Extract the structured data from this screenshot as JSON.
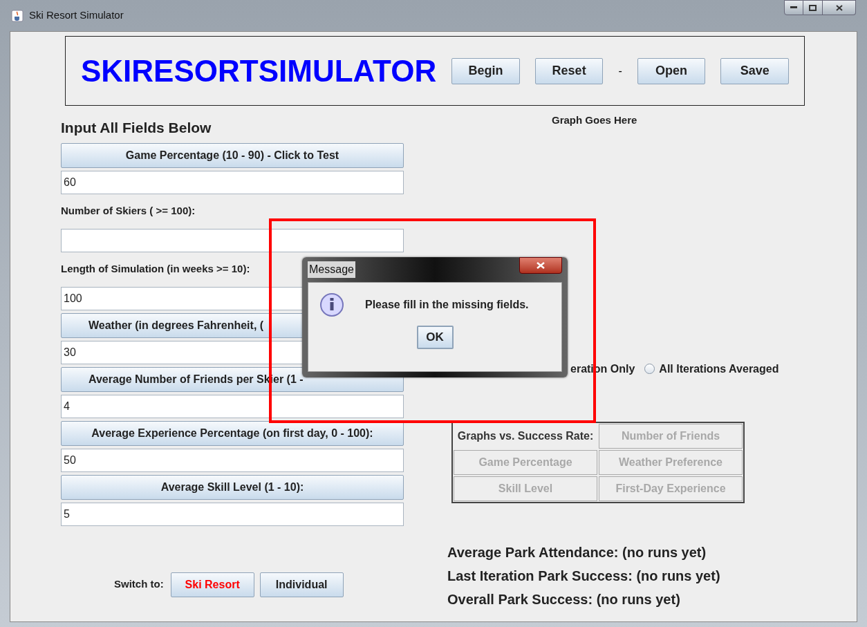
{
  "window": {
    "title": "Ski Resort Simulator"
  },
  "header": {
    "title": "SKIRESORTSIMULATOR",
    "buttons": [
      {
        "label": "Begin",
        "kind": "button"
      },
      {
        "label": "Reset",
        "kind": "button"
      },
      {
        "label": "-",
        "kind": "separator"
      },
      {
        "label": "Open",
        "kind": "button"
      },
      {
        "label": "Save",
        "kind": "button"
      }
    ]
  },
  "form": {
    "heading": "Input All Fields Below",
    "items": [
      {
        "kind": "button",
        "label": "Game Percentage (10 - 90) - Click to Test"
      },
      {
        "kind": "field",
        "value": "60"
      },
      {
        "kind": "label",
        "label": "Number of Skiers ( >= 100):"
      },
      {
        "kind": "field",
        "value": ""
      },
      {
        "kind": "label",
        "label": "Length of Simulation (in weeks >= 10):"
      },
      {
        "kind": "field",
        "value": "100"
      },
      {
        "kind": "covered_button",
        "label": "Weather (in degrees Fahrenheit, ("
      },
      {
        "kind": "field",
        "value": "30"
      },
      {
        "kind": "covered_button",
        "label": "Average Number of Friends per Skier (1 -"
      },
      {
        "kind": "field",
        "value": "4"
      },
      {
        "kind": "button",
        "label": "Average Experience Percentage (on first day, 0 - 100):"
      },
      {
        "kind": "field",
        "value": "50"
      },
      {
        "kind": "button",
        "label": "Average Skill Level (1 - 10):"
      },
      {
        "kind": "field",
        "value": "5"
      }
    ]
  },
  "switch": {
    "label": "Switch to:",
    "buttons": [
      {
        "label": "Ski Resort",
        "selected": true
      },
      {
        "label": "Individual",
        "selected": false
      }
    ]
  },
  "graph": {
    "caption": "Graph Goes Here"
  },
  "radio_fragment": "eration Only",
  "radio_options": [
    {
      "label": "All Iterations Averaged",
      "selected": false
    }
  ],
  "graph_buttons": [
    {
      "label": "Graphs vs. Success Rate:",
      "kind": "label",
      "disabled": false
    },
    {
      "label": "Number of Friends",
      "kind": "button",
      "disabled": true
    },
    {
      "label": "Game Percentage",
      "kind": "button",
      "disabled": true
    },
    {
      "label": "Weather Preference",
      "kind": "button",
      "disabled": true
    },
    {
      "label": "Skill Level",
      "kind": "button",
      "disabled": true
    },
    {
      "label": "First-Day Experience",
      "kind": "button",
      "disabled": true
    }
  ],
  "stats": [
    "Average Park Attendance: (no runs yet)",
    "Last Iteration Park Success: (no runs yet)",
    "Overall Park Success: (no runs yet)"
  ],
  "dialog": {
    "title": "Message",
    "message": "Please fill in the missing fields.",
    "button": "OK"
  }
}
